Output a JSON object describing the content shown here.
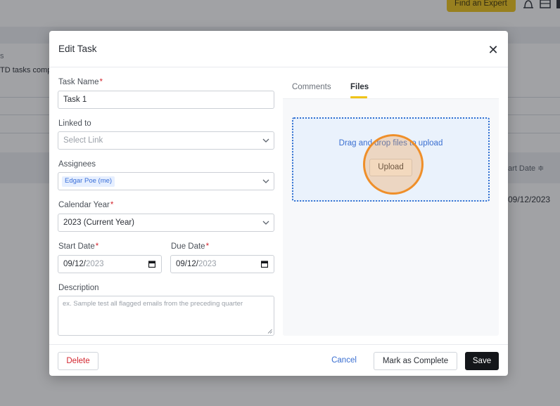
{
  "background": {
    "find_expert_label": "Find an Expert",
    "partial_label_s": "s",
    "partial_tds_text": "TD tasks comp",
    "start_date_header": "art Date ≑",
    "start_date_value": "09/12/2023"
  },
  "modal": {
    "title": "Edit Task",
    "close_glyph": "✕",
    "form": {
      "task_name_label": "Task Name",
      "task_name_value": "Task 1",
      "linked_to_label": "Linked to",
      "linked_to_placeholder": "Select Link",
      "assignees_label": "Assignees",
      "assignee_chip": "Edgar Poe (me)",
      "calendar_year_label": "Calendar Year",
      "calendar_year_value": "2023 (Current Year)",
      "start_date_label": "Start Date",
      "start_date_value_md": "09/12/",
      "start_date_value_year": "2023",
      "due_date_label": "Due Date",
      "due_date_value_md": "09/12/",
      "due_date_value_year": "2023",
      "description_label": "Description",
      "description_placeholder": "ex. Sample test all flagged emails from the preceding quarter",
      "required_mark": "*"
    },
    "panel": {
      "tabs": [
        {
          "label": "Comments",
          "active": false
        },
        {
          "label": "Files",
          "active": true
        }
      ],
      "dropzone_text": "Drag and drop files to upload",
      "upload_label": "Upload"
    },
    "footer": {
      "delete_label": "Delete",
      "cancel_label": "Cancel",
      "complete_label": "Mark as Complete",
      "save_label": "Save"
    }
  },
  "colors": {
    "accent_yellow": "#f0c419",
    "link_blue": "#3a6fd1",
    "danger_red": "#d3262f",
    "highlight_orange": "#ef8f2a"
  },
  "icons": [
    "close-icon",
    "chevron-down-icon",
    "calendar-icon",
    "bell-icon",
    "resize-grip-icon"
  ]
}
